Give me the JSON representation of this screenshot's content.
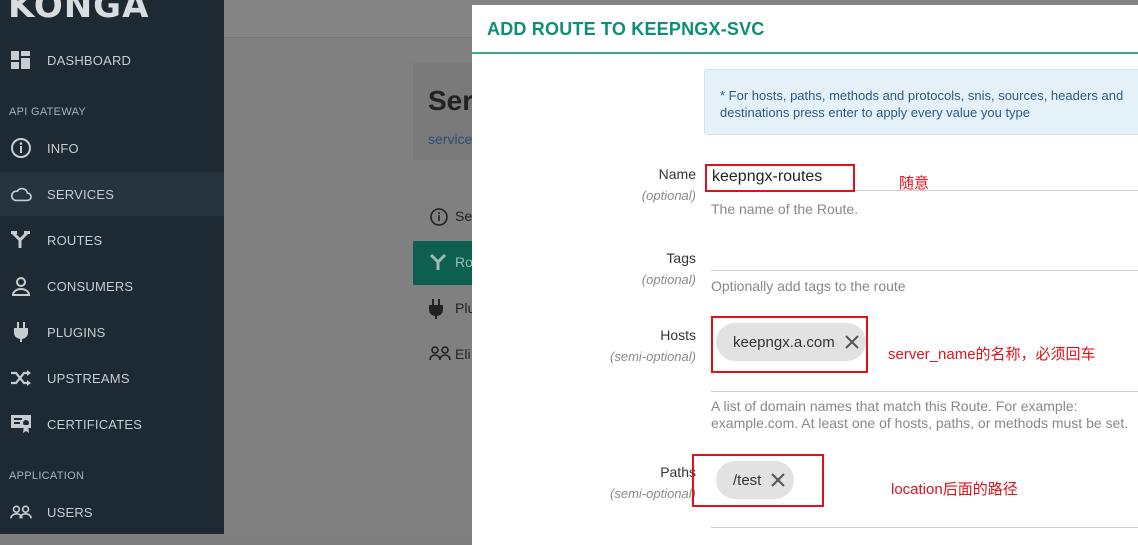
{
  "sidebar": {
    "logo": "KONGA",
    "sections": {
      "api_gateway": "API GATEWAY",
      "application": "APPLICATION"
    },
    "items": [
      {
        "label": "DASHBOARD",
        "icon": "dashboard-icon"
      },
      {
        "label": "INFO",
        "icon": "info-icon"
      },
      {
        "label": "SERVICES",
        "icon": "cloud-icon",
        "active": true
      },
      {
        "label": "ROUTES",
        "icon": "routes-icon"
      },
      {
        "label": "CONSUMERS",
        "icon": "user-icon"
      },
      {
        "label": "PLUGINS",
        "icon": "plug-icon"
      },
      {
        "label": "UPSTREAMS",
        "icon": "shuffle-icon"
      },
      {
        "label": "CERTIFICATES",
        "icon": "certificate-icon"
      },
      {
        "label": "USERS",
        "icon": "users-icon"
      }
    ]
  },
  "background": {
    "title": "Ser",
    "subtitle": "service",
    "tabs": [
      "Se",
      "Ro",
      "Plu",
      "Eli"
    ]
  },
  "modal": {
    "title": "ADD ROUTE TO KEEPNGX-SVC",
    "info": "* For hosts, paths, methods and protocols, snis, sources, headers and destinations press enter to apply every value you type",
    "fields": {
      "name": {
        "label": "Name",
        "qualifier": "(optional)",
        "value": "keepngx-routes",
        "help": "The name of the Route."
      },
      "tags": {
        "label": "Tags",
        "qualifier": "(optional)",
        "help": "Optionally add tags to the route"
      },
      "hosts": {
        "label": "Hosts",
        "qualifier": "(semi-optional)",
        "tag": "keepngx.a.com",
        "help": "A list of domain names that match this Route. For example: example.com. At least one of hosts, paths, or methods must be set."
      },
      "paths": {
        "label": "Paths",
        "qualifier": "(semi-optional)",
        "tag": "/test"
      }
    }
  },
  "annotations": {
    "name": "随意",
    "hosts": "server_name的名称，必须回车",
    "paths": "location后面的路径"
  },
  "colors": {
    "accent": "#0e8f73",
    "annotation": "#e0111b",
    "sidebar": "#1e2a33"
  }
}
